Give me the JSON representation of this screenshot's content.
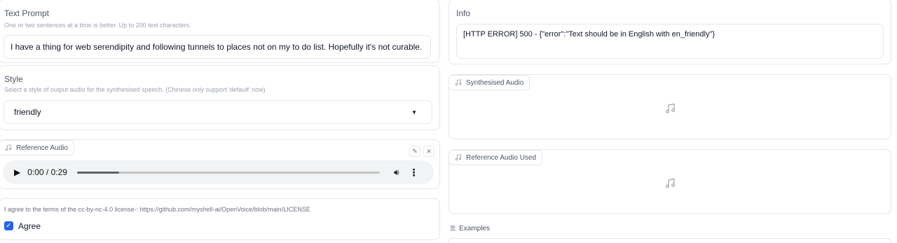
{
  "text_prompt": {
    "label": "Text Prompt",
    "description": "One or two sentences at a time is better. Up to 200 text characters.",
    "value": "I have a thing for web serendipity and following tunnels to places not on my to do list. Hopefully it's not curable."
  },
  "style": {
    "label": "Style",
    "description": "Select a style of output audio for the synthesised speech. (Chinese only support 'default' now)",
    "value": "friendly"
  },
  "reference_audio": {
    "label": "Reference Audio",
    "time": "0:00 / 0:29",
    "progress": 0.14
  },
  "license": {
    "text": "I agree to the terms of the cc-by-nc-4.0 license-: https://github.com/myshell-ai/OpenVoice/blob/main/LICENSE",
    "checkbox_label": "Agree",
    "checked": true
  },
  "info": {
    "label": "Info",
    "value": "[HTTP ERROR] 500 - {\"error\":\"Text should be in English with en_friendly\"}"
  },
  "synthesised_audio": {
    "label": "Synthesised Audio"
  },
  "reference_audio_used": {
    "label": "Reference Audio Used"
  },
  "examples": {
    "label": "Examples"
  },
  "colors": {
    "accent": "#2563eb",
    "border": "#e5e7eb",
    "muted": "#9ca3af"
  }
}
